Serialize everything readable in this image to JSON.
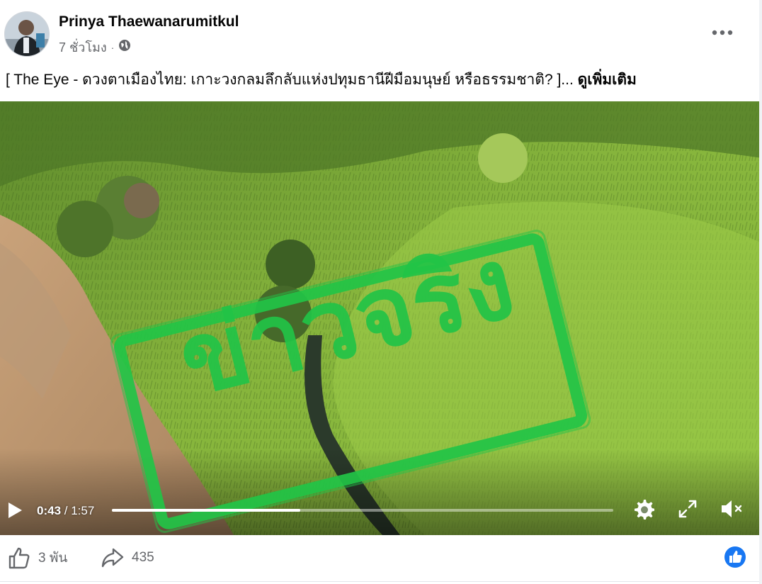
{
  "post": {
    "author": "Prinya Thaewanarumitkul",
    "time": "7 ชั่วโมง",
    "separator": "·",
    "caption": "[ The Eye - ดวงตาเมืองไทย: เกาะวงกลมลึกลับแห่งปทุมธานีฝีมือมนุษย์ หรือธรรมชาติ? ]... ",
    "see_more": "ดูเพิ่มเติม"
  },
  "video": {
    "stamp_text": "ข่าวจริง",
    "current_time": "0:43",
    "time_sep": " / ",
    "duration": "1:57",
    "progress": 0.376
  },
  "footer": {
    "likes": "3 พัน",
    "shares": "435"
  },
  "colors": {
    "stamp": "#22c447",
    "like_blue": "#1877f2",
    "muted_text": "#65676b"
  }
}
